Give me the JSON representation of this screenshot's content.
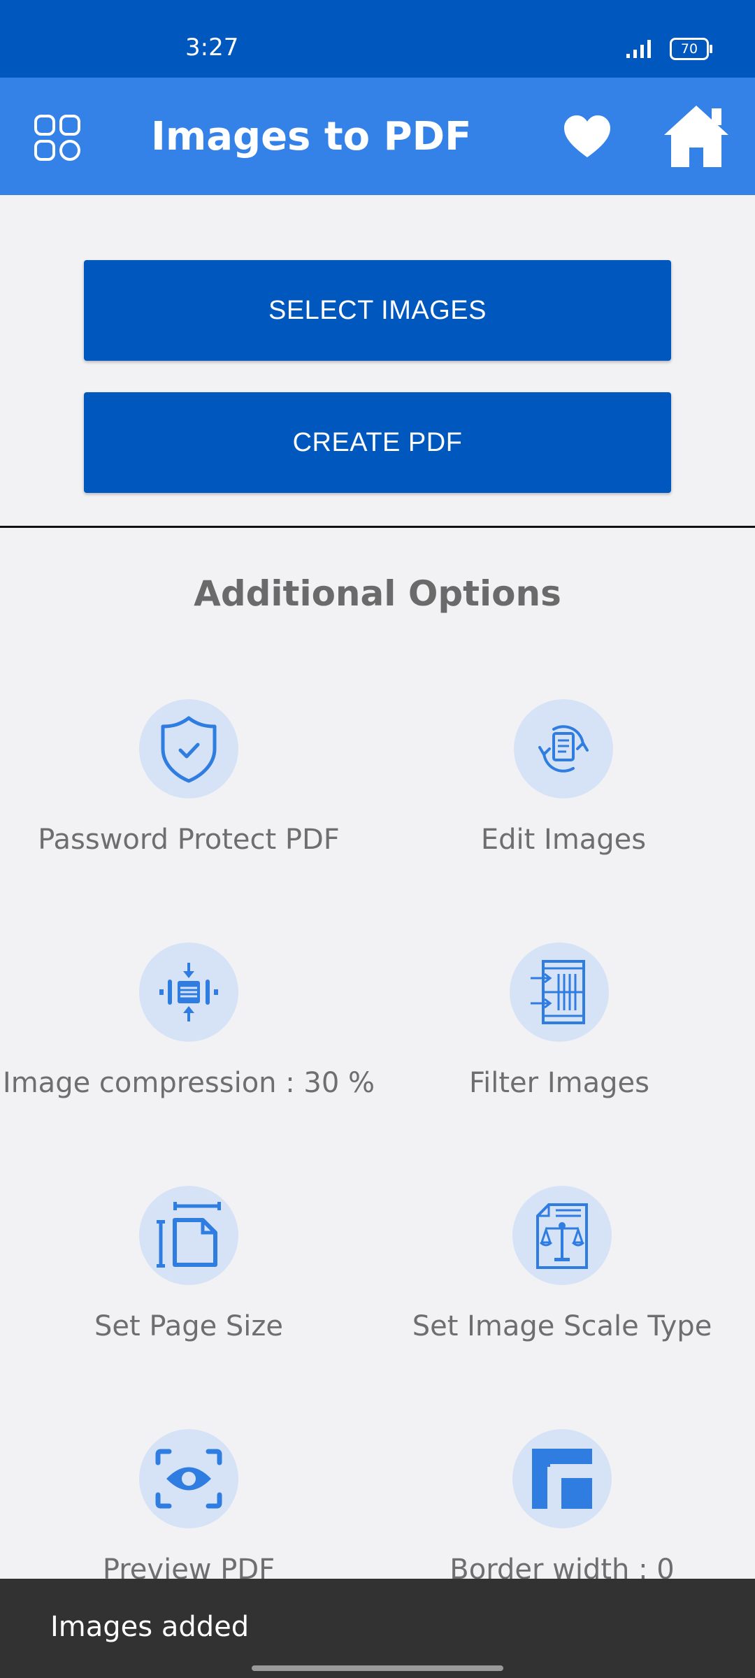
{
  "status_bar": {
    "time": "3:27",
    "battery": "70"
  },
  "app_bar": {
    "title": "Images to PDF",
    "icons": [
      "grid-icon",
      "heart-icon",
      "home-icon"
    ]
  },
  "actions": {
    "select_images": "SELECT IMAGES",
    "create_pdf": "CREATE PDF"
  },
  "options": {
    "title": "Additional Options",
    "items": [
      {
        "label": "Password Protect PDF",
        "icon": "shield-check-icon"
      },
      {
        "label": "Edit Images",
        "icon": "document-refresh-icon"
      },
      {
        "label": "Image compression : 30 %",
        "icon": "compress-icon"
      },
      {
        "label": "Filter Images",
        "icon": "filter-icon"
      },
      {
        "label": "Set Page Size",
        "icon": "page-size-icon"
      },
      {
        "label": "Set Image Scale Type",
        "icon": "scale-document-icon"
      },
      {
        "label": "Preview PDF",
        "icon": "eye-icon"
      },
      {
        "label": "Border width : 0",
        "icon": "border-icon"
      }
    ]
  },
  "snackbar": {
    "message": "Images added"
  },
  "colors": {
    "status_bar": "#0057be",
    "app_bar": "#3482e8",
    "button": "#0057be",
    "icon_accent": "#2f7de1",
    "icon_circle": "#d6e3f6"
  }
}
